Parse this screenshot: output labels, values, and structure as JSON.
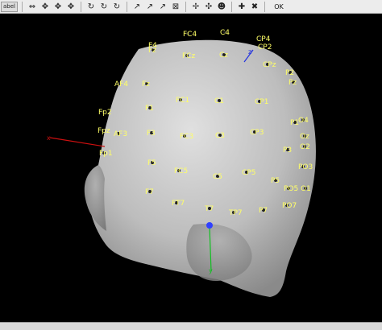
{
  "toolbar": {
    "label_button": "abel",
    "ok_button": "OK",
    "icons": [
      "dual-arrows-icon",
      "move-arrows-icon",
      "move-arrows-2-icon",
      "move-arrows-3-icon",
      "rotate-x-icon",
      "rotate-y-icon",
      "rotate-z-icon",
      "axis-x-icon",
      "axis-y-icon",
      "axis-z-icon",
      "close-small-icon",
      "pan-icon",
      "rotate-3d-icon",
      "head-icon",
      "add-icon",
      "delete-icon"
    ]
  },
  "electrodes": [
    {
      "label": "C4"
    },
    {
      "label": "FC4"
    },
    {
      "label": "F4"
    },
    {
      "label": "Fz"
    },
    {
      "label": "CP4"
    },
    {
      "label": "CP2"
    },
    {
      "label": "FCz"
    },
    {
      "label": "Cz"
    },
    {
      "label": "CPz"
    },
    {
      "label": "P2"
    },
    {
      "label": "Pz"
    },
    {
      "label": "AF4"
    },
    {
      "label": "Fz"
    },
    {
      "label": "FC1"
    },
    {
      "label": "C1"
    },
    {
      "label": "CP1"
    },
    {
      "label": "Fp2"
    },
    {
      "label": "F1"
    },
    {
      "label": "P1"
    },
    {
      "label": "O4"
    },
    {
      "label": "Fpz"
    },
    {
      "label": "AF3"
    },
    {
      "label": "F3"
    },
    {
      "label": "FC3"
    },
    {
      "label": "C3"
    },
    {
      "label": "CP3"
    },
    {
      "label": "Oz"
    },
    {
      "label": "O2"
    },
    {
      "label": "Fp1"
    },
    {
      "label": "P3"
    },
    {
      "label": "F5"
    },
    {
      "label": "FC5"
    },
    {
      "label": "C5"
    },
    {
      "label": "CP5"
    },
    {
      "label": "PO3"
    },
    {
      "label": "P5"
    },
    {
      "label": "PO5"
    },
    {
      "label": "O1"
    },
    {
      "label": "F7"
    },
    {
      "label": "FT7"
    },
    {
      "label": "T7"
    },
    {
      "label": "TP7"
    },
    {
      "label": "P7"
    },
    {
      "label": "PO7"
    }
  ],
  "colors": {
    "background": "#000000",
    "head": "#c8c8c8",
    "electrode_label": "#ffff66",
    "axis_x": "#d01010",
    "axis_y": "#10c020",
    "axis_z": "#2030e0"
  }
}
